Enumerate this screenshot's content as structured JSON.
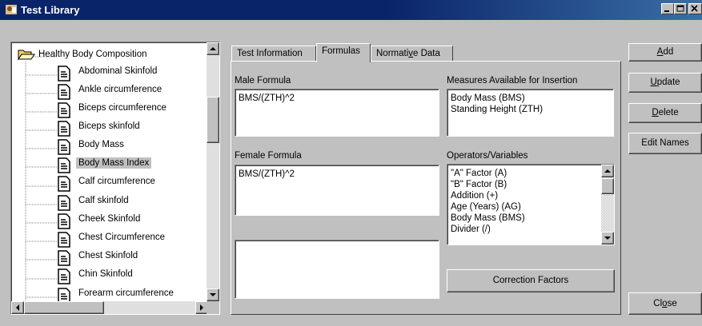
{
  "window": {
    "title": "Test Library"
  },
  "tree": {
    "root": "Healthy Body Composition",
    "items": [
      "Abdominal Skinfold",
      "Ankle circumference",
      "Biceps circumference",
      "Biceps skinfold",
      "Body Mass",
      "Body Mass Index",
      "Calf circumference",
      "Calf skinfold",
      "Cheek Skinfold",
      "Chest Circumference",
      "Chest Skinfold",
      "Chin Skinfold",
      "Forearm circumference"
    ],
    "selected": "Body Mass Index"
  },
  "tabs": {
    "info": "Test Information",
    "formulas": "Formulas",
    "norm_pre": "Normati",
    "norm_u": "v",
    "norm_post": "e Data"
  },
  "formulas": {
    "male_label": "Male Formula",
    "male_value": "BMS/(ZTH)^2",
    "female_label": "Female Formula",
    "female_value": "BMS/(ZTH)^2",
    "measures_label": "Measures Available for Insertion",
    "measures": [
      "Body Mass (BMS)",
      "Standing  Height (ZTH)"
    ],
    "operators_label": "Operators/Variables",
    "operators": [
      "\"A\" Factor (A)",
      "\"B\" Factor (B)",
      "Addition (+)",
      "Age (Years) (AG)",
      "Body Mass (BMS)",
      "Divider (/)"
    ],
    "correction_button": "Correction Factors"
  },
  "buttons": {
    "add_u": "A",
    "add_rest": "dd",
    "update_u": "U",
    "update_rest": "pdate",
    "delete_u": "D",
    "delete_rest": "elete",
    "edit_names": "Edit Names",
    "close_pre": "Cl",
    "close_u": "o",
    "close_post": "se"
  }
}
